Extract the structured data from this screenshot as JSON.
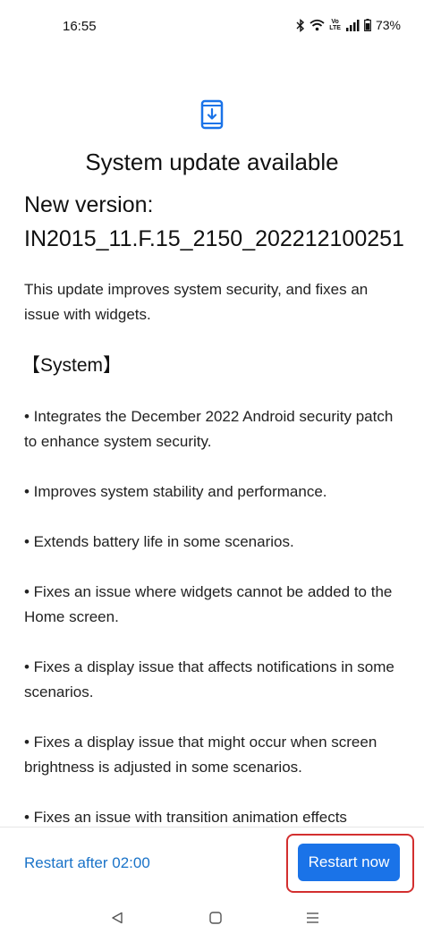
{
  "status_bar": {
    "time": "16:55",
    "volte_top": "Vo",
    "volte_bottom": "LTE",
    "battery": "73%"
  },
  "header": {
    "icon": "system-update-icon",
    "title": "System update available",
    "version_label": "New version:",
    "version_value": "IN2015_11.F.15_2150_202212100251"
  },
  "content": {
    "summary": "This update improves system security, and fixes an issue with widgets.",
    "section_title": "【System】",
    "items": [
      "• Integrates the December 2022 Android security patch to enhance system security.",
      "• Improves system stability and performance.",
      "• Extends battery life in some scenarios.",
      "• Fixes an issue where widgets cannot be added to the Home screen.",
      "• Fixes a display issue that affects notifications in some scenarios.",
      "• Fixes a display issue that might occur when screen brightness is adjusted in some scenarios.",
      "• Fixes an issue with transition animation effects"
    ]
  },
  "actions": {
    "restart_later": "Restart after 02:00",
    "restart_now": "Restart now"
  },
  "nav": {
    "back": "back-icon",
    "home": "home-icon",
    "recents": "recents-icon"
  },
  "colors": {
    "accent": "#1a73e8",
    "link": "#1a73c8",
    "highlight": "#d32f2f"
  }
}
